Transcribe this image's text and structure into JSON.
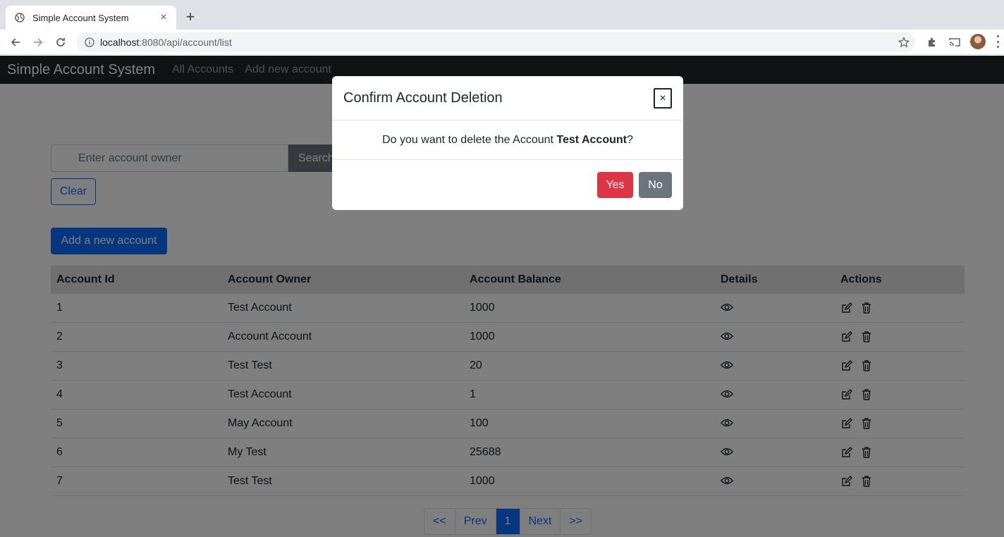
{
  "browser": {
    "tab_title": "Simple Account System",
    "url_host": "localhost",
    "url_rest": ":8080/api/account/list"
  },
  "navbar": {
    "brand": "Simple Account System",
    "links": [
      "All Accounts",
      "Add new account"
    ]
  },
  "search": {
    "placeholder": "Enter account owner",
    "button_label": "Search",
    "clear_label": "Clear"
  },
  "add_button_label": "Add a new account",
  "table": {
    "headers": [
      "Account Id",
      "Account Owner",
      "Account Balance",
      "Details",
      "Actions"
    ],
    "rows": [
      {
        "id": "1",
        "owner": "Test Account",
        "balance": "1000"
      },
      {
        "id": "2",
        "owner": "Account Account",
        "balance": "1000"
      },
      {
        "id": "3",
        "owner": "Test Test",
        "balance": "20"
      },
      {
        "id": "4",
        "owner": "Test Account",
        "balance": "1"
      },
      {
        "id": "5",
        "owner": "May Account",
        "balance": "100"
      },
      {
        "id": "6",
        "owner": "My Test",
        "balance": "25688"
      },
      {
        "id": "7",
        "owner": "Test Test",
        "balance": "1000"
      }
    ]
  },
  "pagination": {
    "first": "<<",
    "prev": "Prev",
    "current": "1",
    "next": "Next",
    "last": ">>"
  },
  "modal": {
    "title": "Confirm Account Deletion",
    "close_label": "×",
    "message_prefix": "Do you want to delete the Account ",
    "account_name": "Test Account",
    "message_suffix": "?",
    "yes_label": "Yes",
    "no_label": "No"
  },
  "colors": {
    "primary": "#0d6efd",
    "danger": "#dc3545",
    "secondary": "#6c757d",
    "navbar": "#212529"
  }
}
